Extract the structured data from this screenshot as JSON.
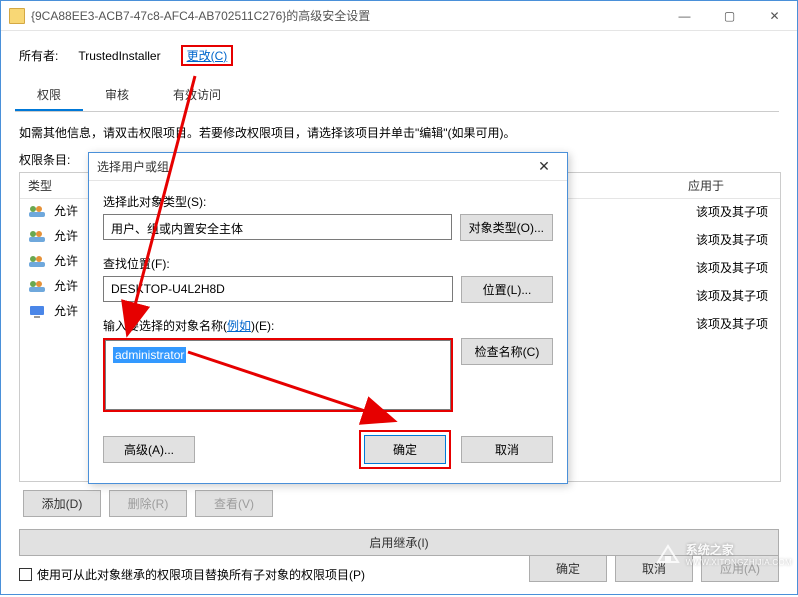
{
  "window": {
    "title": "{9CA88EE3-ACB7-47c8-AFC4-AB702511C276}的高级安全设置",
    "owner_label": "所有者:",
    "owner_value": "TrustedInstaller",
    "change_link": "更改(C)",
    "tabs": {
      "perm": "权限",
      "audit": "审核",
      "eff": "有效访问"
    },
    "hint": "如需其他信息，请双击权限项目。若要修改权限项目，请选择该项目并单击\"编辑\"(如果可用)。",
    "perm_label": "权限条目:",
    "columns": {
      "type": "类型",
      "principal": "",
      "access": "",
      "inherit": "",
      "apply": "应用于"
    },
    "rows": [
      {
        "type": "允许",
        "apply": "该项及其子项"
      },
      {
        "type": "允许",
        "apply": "该项及其子项"
      },
      {
        "type": "允许",
        "apply": "该项及其子项"
      },
      {
        "type": "允许",
        "apply": "该项及其子项"
      },
      {
        "type": "允许",
        "apply": "该项及其子项"
      }
    ],
    "buttons": {
      "add": "添加(D)",
      "remove": "删除(R)",
      "view": "查看(V)",
      "enable_inherit": "启用继承(I)",
      "replace_children": "使用可从此对象继承的权限项目替换所有子对象的权限项目(P)",
      "ok": "确定",
      "cancel": "取消",
      "apply_btn": "应用(A)"
    }
  },
  "dialog": {
    "title": "选择用户或组",
    "obj_type_label": "选择此对象类型(S):",
    "obj_type_value": "用户、组或内置安全主体",
    "obj_type_btn": "对象类型(O)...",
    "loc_label": "查找位置(F):",
    "loc_value": "DESKTOP-U4L2H8D",
    "loc_btn": "位置(L)...",
    "name_label_pre": "输入要选择的对象名称(",
    "name_label_link": "例如",
    "name_label_post": ")(E):",
    "name_value": "administrator",
    "check_btn": "检查名称(C)",
    "advanced_btn": "高级(A)...",
    "ok": "确定",
    "cancel": "取消"
  },
  "watermark": {
    "text": "系统之家",
    "url": "WWW.XITONGZHIJIA.COM"
  }
}
